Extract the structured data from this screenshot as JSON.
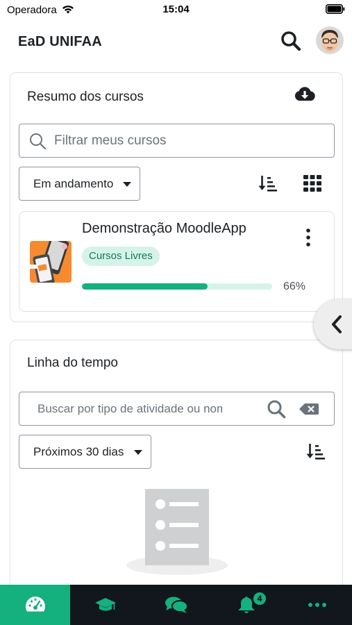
{
  "status_bar": {
    "carrier": "Operadora",
    "time": "15:04"
  },
  "header": {
    "title": "EaD UNIFAA",
    "search_icon": "search-icon",
    "avatar_icon": "avatar"
  },
  "course_overview": {
    "title": "Resumo dos cursos",
    "download_icon": "cloud-download-icon",
    "filter_placeholder": "Filtrar meus cursos",
    "status_selected": "Em andamento",
    "sort_icon": "sort-icon",
    "view_icon": "grid-view-icon",
    "courses": [
      {
        "name": "Demonstração MoodleApp",
        "category": "Cursos Livres",
        "progress_percent": 66,
        "progress_label": "66%"
      }
    ]
  },
  "timeline": {
    "title": "Linha do tempo",
    "search_placeholder": "Buscar por tipo de atividade ou nome",
    "period_selected": "Próximos 30 dias",
    "sort_icon": "sort-icon",
    "empty_icon": "empty-list-icon"
  },
  "bottom_tabs": [
    {
      "icon": "dashboard-icon",
      "active": true
    },
    {
      "icon": "graduation-cap-icon",
      "active": false
    },
    {
      "icon": "chat-bubbles-icon",
      "active": false
    },
    {
      "icon": "bell-icon",
      "active": false,
      "badge": "4"
    },
    {
      "icon": "more-icon",
      "active": false
    }
  ],
  "colors": {
    "accent": "#14b07d",
    "tab_bar": "#11171c",
    "badge_bg": "#d6f3ea",
    "badge_text": "#0f7a58"
  }
}
